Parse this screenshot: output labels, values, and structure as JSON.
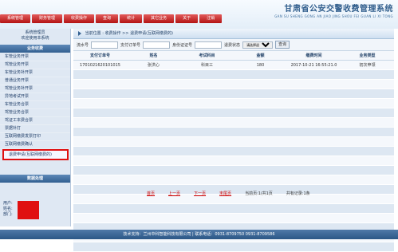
{
  "header": {
    "title": "甘肃省公安交警收费管理系统",
    "subtitle": "GAN SU SHENG GONG AN JIAO JING SHOU FEI GUAN LI XI TONG",
    "nav": [
      "系统管理",
      "财务管理",
      "收费操作",
      "查询",
      "统计",
      "其它业务",
      "关于",
      "注销"
    ]
  },
  "sidebar": {
    "user_lines": [
      "系统管理员",
      "欢迎使用本系统"
    ],
    "section_title": "业务收费",
    "items": [
      "车管业务开票",
      "驾管业务开票",
      "车管业务补开票",
      "普通业务开票",
      "驾管业务补开票",
      "异地考试开票",
      "车管业务合票",
      "驾管业务合票",
      "驾证工本费合票",
      "票据补打",
      "互联网缴费发票打印",
      "互联网缴费确认",
      "退费申请(互联网缴费的)"
    ],
    "selected_index": 12,
    "section2_title": "数据处理",
    "info_labels": [
      "用户:",
      "姓名:",
      "部门:"
    ]
  },
  "main": {
    "breadcrumb": {
      "prefix": "当前位置",
      "parts": [
        "收费操作",
        "退费申请(互联网缴费的)"
      ]
    },
    "search": {
      "labels": [
        "流水号",
        "支付订单号",
        "身份证证号",
        "退费状态"
      ],
      "status_value": "请选择退费状态",
      "button": "查询"
    },
    "table": {
      "headers": [
        "支付订单号",
        "姓名",
        "考试科目",
        "金额",
        "缴费时间",
        "业务类型"
      ],
      "rows": [
        [
          "1701021620101015",
          "张洪心",
          "科目三",
          "180",
          "2017-10-21 16:55:21.0",
          "初次申领"
        ]
      ],
      "empty_rows": 19
    },
    "pager": {
      "first": "首页",
      "prev": "上一页",
      "next": "下一页",
      "last": "末尾页",
      "page_info": "当前页:1/共1页",
      "total": "共有记录:1条"
    }
  },
  "footer": {
    "text": "技术支持：兰州中科智能科技有限公司 | 联系电话：0931-8709750 0931-8709586"
  },
  "colors": {
    "nav_red": "#c62222",
    "accent_blue": "#325f90",
    "highlight_red": "#e01010"
  }
}
